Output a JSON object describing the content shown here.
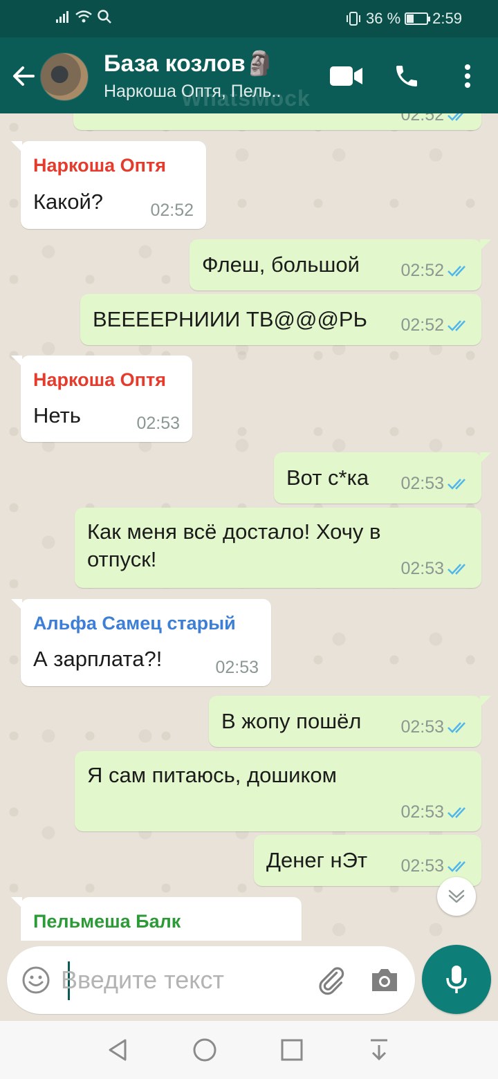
{
  "status_bar": {
    "battery": "36 %",
    "battery_level": 0.36,
    "time": "2:59"
  },
  "header": {
    "title": "База козлов🗿",
    "subtitle": "Наркоша Оптя, Пель..",
    "watermark": "WhatsMock"
  },
  "colors": {
    "header_bg": "#0b5c56",
    "status_bg": "#0b4f4a",
    "outgoing_bubble": "#e2f7cb",
    "incoming_bubble": "#ffffff",
    "read_ticks": "#4fb6ec",
    "sender_red": "#e53b2c",
    "sender_blue": "#3d7fd6",
    "sender_green": "#2c9a37",
    "mic_button": "#0d7f78"
  },
  "messages": [
    {
      "direction": "out",
      "text": "",
      "time": "02:52",
      "status": "read",
      "partial": true
    },
    {
      "direction": "in",
      "sender": "Наркоша Оптя",
      "sender_color": "#e53b2c",
      "text": "Какой?",
      "time": "02:52"
    },
    {
      "direction": "out",
      "text": "Флеш, большой",
      "time": "02:52",
      "status": "read"
    },
    {
      "direction": "out",
      "text": "ВЕЕЕЕРНИИИ ТВ@@@РЬ",
      "time": "02:52",
      "status": "read"
    },
    {
      "direction": "in",
      "sender": "Наркоша Оптя",
      "sender_color": "#e53b2c",
      "text": "Неть",
      "time": "02:53"
    },
    {
      "direction": "out",
      "text": "Вот с*ка",
      "time": "02:53",
      "status": "read"
    },
    {
      "direction": "out",
      "text_lines": [
        "Как меня всё достало! Хочу в",
        "отпуск!"
      ],
      "time": "02:53",
      "status": "read"
    },
    {
      "direction": "in",
      "sender": "Альфа Самец старый",
      "sender_color": "#3d7fd6",
      "text": "А зарплата?!",
      "time": "02:53"
    },
    {
      "direction": "out",
      "text": "В жопу пошёл",
      "time": "02:53",
      "status": "read"
    },
    {
      "direction": "out",
      "text": "Я сам питаюсь, дошиком",
      "time": "02:53",
      "status": "read"
    },
    {
      "direction": "out",
      "text": "Денег нЭт",
      "time": "02:53",
      "status": "read"
    },
    {
      "direction": "in",
      "sender": "Пельмеша Балк",
      "sender_color": "#2c9a37",
      "text": "",
      "partial": true
    }
  ],
  "input": {
    "placeholder": "Введите текст",
    "value": ""
  },
  "icons": {
    "back": "arrow-left-icon",
    "video": "video-camera-icon",
    "call": "phone-icon",
    "menu": "more-vertical-icon",
    "emoji": "emoji-icon",
    "attach": "paperclip-icon",
    "camera": "camera-icon",
    "mic": "microphone-icon",
    "scroll_down": "chevron-double-down-icon"
  }
}
